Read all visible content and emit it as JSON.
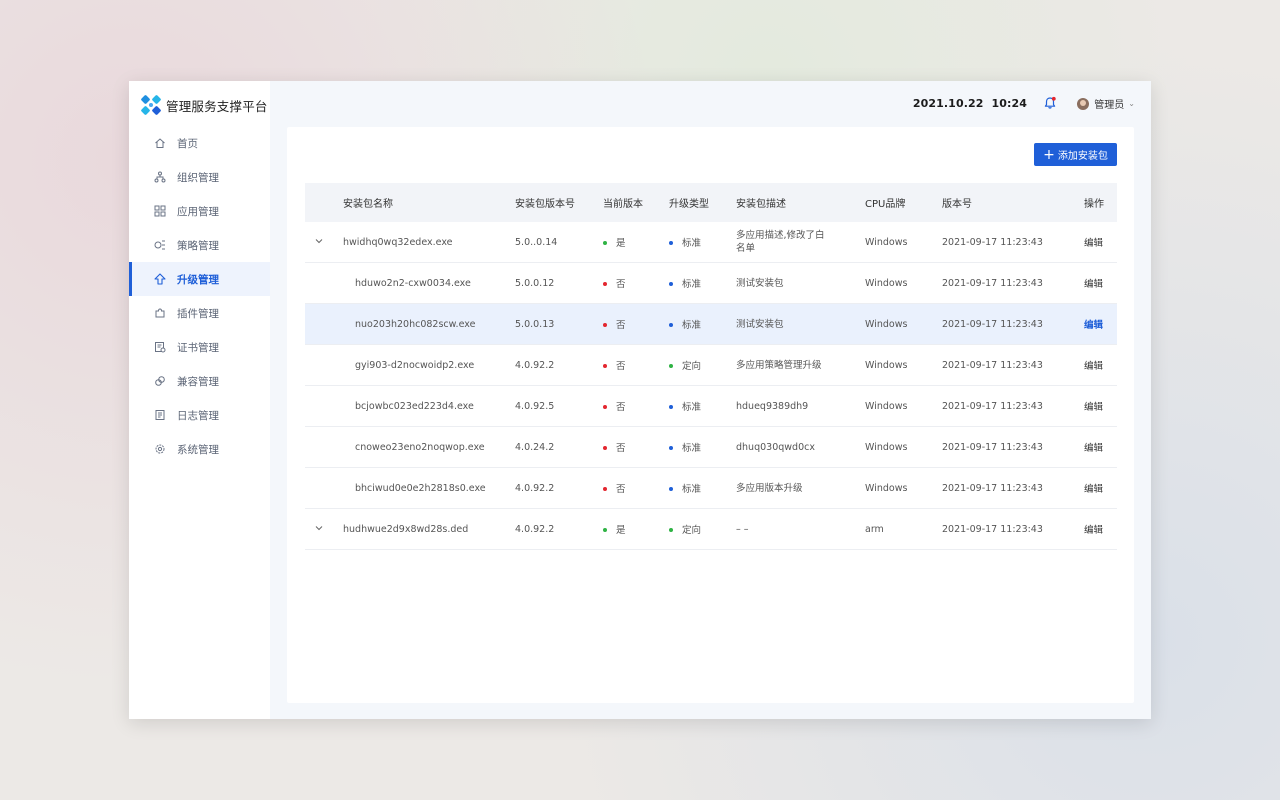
{
  "app": {
    "title": "管理服务支撑平台"
  },
  "sidebar": {
    "items": [
      {
        "label": "首页",
        "icon": "home-icon"
      },
      {
        "label": "组织管理",
        "icon": "org-tree-icon"
      },
      {
        "label": "应用管理",
        "icon": "apps-grid-icon"
      },
      {
        "label": "策略管理",
        "icon": "strategy-icon"
      },
      {
        "label": "升级管理",
        "icon": "upgrade-arrow-icon",
        "active": true
      },
      {
        "label": "插件管理",
        "icon": "puzzle-icon"
      },
      {
        "label": "证书管理",
        "icon": "certificate-icon"
      },
      {
        "label": "兼容管理",
        "icon": "link-icon"
      },
      {
        "label": "日志管理",
        "icon": "log-icon"
      },
      {
        "label": "系统管理",
        "icon": "gear-icon"
      }
    ]
  },
  "header": {
    "date": "2021.10.22",
    "time": "10:24",
    "user": "管理员"
  },
  "toolbar": {
    "add_label": "添加安装包"
  },
  "table": {
    "columns": [
      "安装包名称",
      "安装包版本号",
      "当前版本",
      "升级类型",
      "安装包描述",
      "CPU品牌",
      "版本号",
      "操作"
    ],
    "rows": [
      {
        "expand": true,
        "name": "hwidhq0wq32edex.exe",
        "version": "5.0..0.14",
        "current": "是",
        "current_status": "yes",
        "type": "标准",
        "type_kind": "standard",
        "desc": "多应用描述,修改了白名单",
        "cpu": "Windows",
        "date": "2021-09-17 11:23:43",
        "action": "编辑"
      },
      {
        "expand": false,
        "name": "hduwo2n2-cxw0034.exe",
        "version": "5.0.0.12",
        "current": "否",
        "current_status": "no",
        "type": "标准",
        "type_kind": "standard",
        "desc": "测试安装包",
        "cpu": "Windows",
        "date": "2021-09-17 11:23:43",
        "action": "编辑"
      },
      {
        "expand": false,
        "name": "nuo203h20hc082scw.exe",
        "version": "5.0.0.13",
        "current": "否",
        "current_status": "no",
        "type": "标准",
        "type_kind": "standard",
        "desc": "测试安装包",
        "cpu": "Windows",
        "date": "2021-09-17 11:23:43",
        "action": "编辑",
        "highlight": true
      },
      {
        "expand": false,
        "name": "gyi903-d2nocwoidp2.exe",
        "version": "4.0.92.2",
        "current": "否",
        "current_status": "no",
        "type": "定向",
        "type_kind": "directed",
        "desc": "多应用策略管理升级",
        "cpu": "Windows",
        "date": "2021-09-17 11:23:43",
        "action": "编辑"
      },
      {
        "expand": false,
        "name": "bcjowbc023ed223d4.exe",
        "version": "4.0.92.5",
        "current": "否",
        "current_status": "no",
        "type": "标准",
        "type_kind": "standard",
        "desc": "hdueq9389dh9",
        "cpu": "Windows",
        "date": "2021-09-17 11:23:43",
        "action": "编辑"
      },
      {
        "expand": false,
        "name": "cnoweo23eno2noqwop.exe",
        "version": "4.0.24.2",
        "current": "否",
        "current_status": "no",
        "type": "标准",
        "type_kind": "standard",
        "desc": "dhuq030qwd0cx",
        "cpu": "Windows",
        "date": "2021-09-17 11:23:43",
        "action": "编辑"
      },
      {
        "expand": false,
        "name": "bhciwud0e0e2h2818s0.exe",
        "version": "4.0.92.2",
        "current": "否",
        "current_status": "no",
        "type": "标准",
        "type_kind": "standard",
        "desc": "多应用版本升级",
        "cpu": "Windows",
        "date": "2021-09-17 11:23:43",
        "action": "编辑"
      },
      {
        "expand": true,
        "name": "hudhwue2d9x8wd28s.ded",
        "version": "4.0.92.2",
        "current": "是",
        "current_status": "yes",
        "type": "定向",
        "type_kind": "directed",
        "desc": "– –",
        "cpu": "arm",
        "date": "2021-09-17 11:23:43",
        "action": "编辑"
      }
    ]
  },
  "colors": {
    "accent": "#1f5fd8",
    "status_yes": "#2fb344",
    "status_no": "#e3262f",
    "type_standard": "#1f5fd8",
    "type_directed": "#2fb344"
  }
}
